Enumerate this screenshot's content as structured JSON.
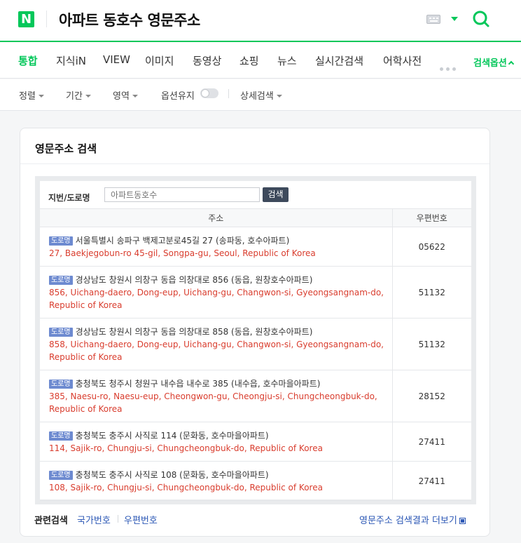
{
  "header": {
    "logo": "N",
    "query": "아파트 동호수 영문주소",
    "icons": [
      "keyboard-icon",
      "caret-down-icon",
      "search-icon"
    ],
    "accent": "#03c75a"
  },
  "nav": {
    "tabs": [
      {
        "label": "통합",
        "active": true
      },
      {
        "label": "지식iN"
      },
      {
        "label": "VIEW"
      },
      {
        "label": "이미지"
      },
      {
        "label": "동영상"
      },
      {
        "label": "쇼핑"
      },
      {
        "label": "뉴스"
      },
      {
        "label": "실시간검색"
      },
      {
        "label": "어학사전"
      }
    ],
    "options_label": "검색옵션"
  },
  "filters": {
    "sort": "정렬",
    "period": "기간",
    "area": "영역",
    "keep_options": "옵션유지",
    "advanced": "상세검색"
  },
  "card": {
    "title": "영문주소 검색",
    "search_label": "지번/도로명",
    "search_placeholder": "아파트동호수",
    "search_button": "검색",
    "columns": [
      "주소",
      "우편번호"
    ],
    "tag_label": "도로명",
    "rows": [
      {
        "kor": "서울특별시 송파구 백제고분로45길 27 (송파동, 호수아파트)",
        "eng": "27, Baekjegobun-ro 45-gil, Songpa-gu, Seoul, Republic of Korea",
        "zip": "05622"
      },
      {
        "kor": "경상남도 창원시 의창구 동읍 의창대로 856 (동읍, 원창호수아파트)",
        "eng": "856, Uichang-daero, Dong-eup, Uichang-gu, Changwon-si, Gyeongsangnam-do, Republic of Korea",
        "zip": "51132"
      },
      {
        "kor": "경상남도 창원시 의창구 동읍 의창대로 858 (동읍, 원창호수아파트)",
        "eng": "858, Uichang-daero, Dong-eup, Uichang-gu, Changwon-si, Gyeongsangnam-do, Republic of Korea",
        "zip": "51132"
      },
      {
        "kor": "충청북도 청주시 청원구 내수읍 내수로 385 (내수읍, 호수마을아파트)",
        "eng": "385, Naesu-ro, Naesu-eup, Cheongwon-gu, Cheongju-si, Chungcheongbuk-do, Republic of Korea",
        "zip": "28152"
      },
      {
        "kor": "충청북도 충주시 사직로 114 (문화동, 호수마을아파트)",
        "eng": "114, Sajik-ro, Chungju-si, Chungcheongbuk-do, Republic of Korea",
        "zip": "27411"
      },
      {
        "kor": "충청북도 충주시 사직로 108 (문화동, 호수마을아파트)",
        "eng": "108, Sajik-ro, Chungju-si, Chungcheongbuk-do, Republic of Korea",
        "zip": "27411"
      }
    ],
    "related_label": "관련검색",
    "related": [
      "국가번호",
      "우편번호"
    ],
    "more_link": "영문주소 검색결과 더보기"
  }
}
